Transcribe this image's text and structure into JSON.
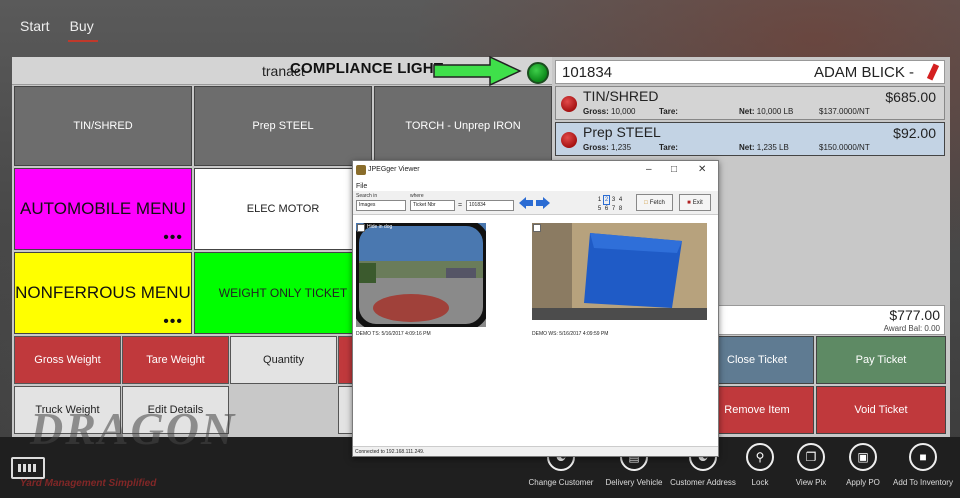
{
  "nav": {
    "start": "Start",
    "buy": "Buy"
  },
  "header": {
    "tranact": "tranact",
    "compliance_label": "COMPLIANCE LIGHT"
  },
  "categories": [
    {
      "label": "TIN/SHRED",
      "color": "#6d6d6d"
    },
    {
      "label": "Prep STEEL",
      "color": "#6d6d6d"
    },
    {
      "label": "TORCH - Unprep IRON",
      "color": "#6d6d6d"
    },
    {
      "label": "AUTOMOBILE MENU",
      "color": "#ff00ff",
      "dots": "•••"
    },
    {
      "label": "ELEC MOTOR",
      "color": "#ffffff"
    },
    {
      "label": "NONFERROUS MENU",
      "color": "#ffff00",
      "dots": "•••"
    },
    {
      "label": "WEIGHT ONLY TICKET",
      "color": "#00ff00"
    }
  ],
  "actions": {
    "gross_weight": "Gross Weight",
    "tare_weight": "Tare Weight",
    "quantity": "Quantity",
    "truck_weight": "Truck Weight",
    "edit_details": "Edit Details"
  },
  "ticket": {
    "number": "101834",
    "customer": "ADAM BLICK -",
    "items": [
      {
        "name": "TIN/SHRED",
        "price": "$685.00",
        "gross_label": "Gross:",
        "gross": "10,000",
        "tare_label": "Tare:",
        "net_label": "Net:",
        "net": "10,000 LB",
        "rate": "$137.0000/NT"
      },
      {
        "name": "Prep STEEL",
        "price": "$92.00",
        "gross_label": "Gross:",
        "gross": "1,235",
        "tare_label": "Tare:",
        "net_label": "Net:",
        "net": "1,235 LB",
        "rate": "$150.0000/NT"
      }
    ],
    "total": "$777.00",
    "award_bal": "Award Bal: 0.00"
  },
  "ticket_buttons": {
    "close": "Close Ticket",
    "pay": "Pay Ticket",
    "remove": "Remove Item",
    "void": "Void Ticket"
  },
  "viewer": {
    "title": "JPEGger Viewer",
    "menu_file": "File",
    "search_in_label": "Search in",
    "search_in_value": "Images",
    "where_label": "where",
    "where_value": "Ticket Nbr",
    "equals": "=",
    "search_value": "101834",
    "pages": [
      "1",
      "2",
      "3",
      "4",
      "5",
      "6",
      "7",
      "8"
    ],
    "fetch": "Fetch",
    "exit": "Exit",
    "hide_in_dog": "Hide in dog",
    "caption1": "DEMO TS: 5/16/2017 4:09:16 PM",
    "caption2": "DEMO WS: 5/16/2017 4:09:59 PM",
    "status": "Connected to 192.168.111.249."
  },
  "logo": {
    "text": "DRAGON",
    "sub": "Yard Management Simplified"
  },
  "appbar": [
    {
      "label": "Change Customer",
      "icon": "person-card-icon"
    },
    {
      "label": "Delivery Vehicle",
      "icon": "vehicle-icon"
    },
    {
      "label": "Customer Address",
      "icon": "address-card-icon"
    },
    {
      "label": "Lock",
      "icon": "lock-icon"
    },
    {
      "label": "View Pix",
      "icon": "pictures-icon"
    },
    {
      "label": "Apply PO",
      "icon": "document-icon"
    },
    {
      "label": "Add To Inventory",
      "icon": "inventory-icon"
    }
  ]
}
